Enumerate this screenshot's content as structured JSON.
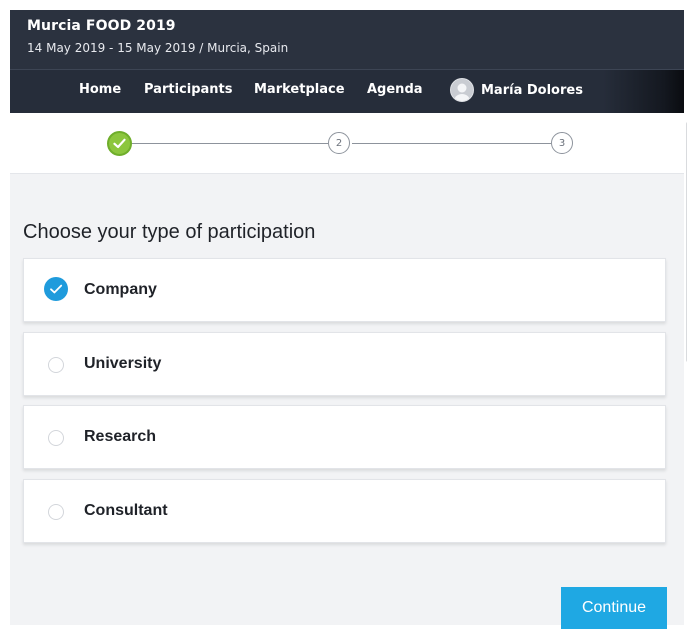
{
  "event": {
    "title": "Murcia FOOD 2019",
    "subtitle": "14 May 2019 - 15 May 2019 / Murcia, Spain"
  },
  "nav": {
    "items": [
      {
        "label": "Home"
      },
      {
        "label": "Participants"
      },
      {
        "label": "Marketplace"
      },
      {
        "label": "Agenda"
      }
    ],
    "user": {
      "name": "María Dolores",
      "icon": "avatar-icon"
    }
  },
  "stepper": {
    "steps": [
      {
        "label": "",
        "state": "completed",
        "icon": "checkmark-icon"
      },
      {
        "label": "2",
        "state": "pending"
      },
      {
        "label": "3",
        "state": "pending"
      }
    ]
  },
  "form": {
    "heading": "Choose your type of participation",
    "options": [
      {
        "label": "Company",
        "selected": true
      },
      {
        "label": "University",
        "selected": false
      },
      {
        "label": "Research",
        "selected": false
      },
      {
        "label": "Consultant",
        "selected": false
      }
    ],
    "continue_label": "Continue"
  },
  "colors": {
    "header_bg": "#2b323f",
    "step_complete": "#8cc63e",
    "radio_selected": "#1f9bdc",
    "primary_button": "#1fa8e3"
  }
}
